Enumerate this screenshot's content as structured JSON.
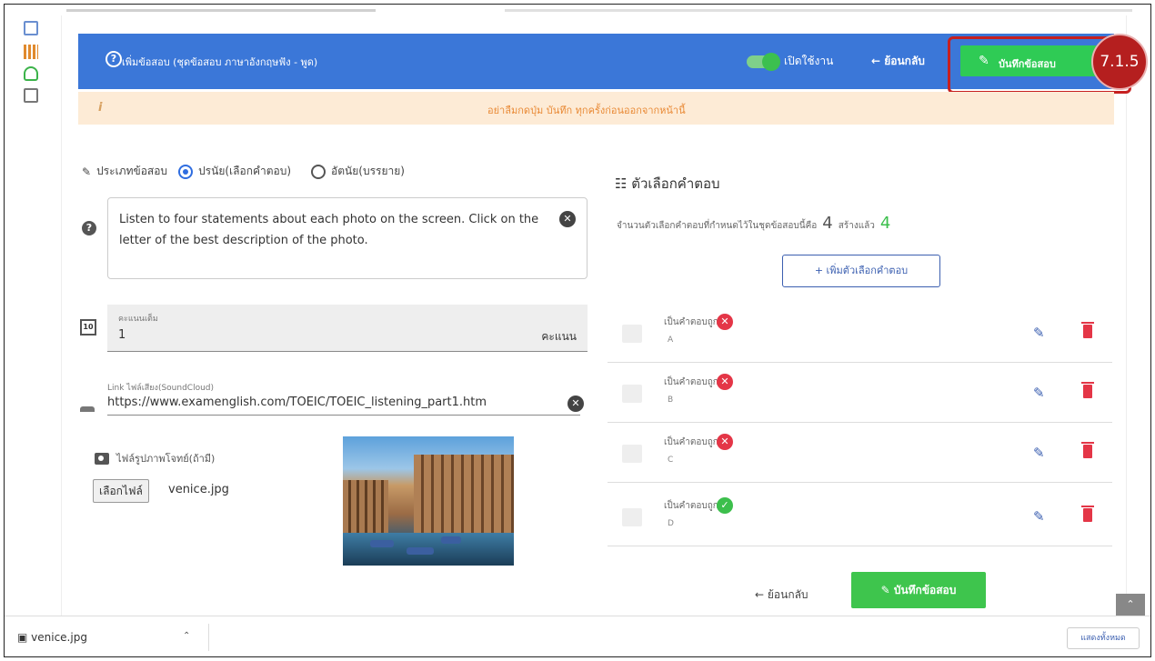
{
  "header": {
    "title": "เพิ่มข้อสอบ (ชุดข้อสอบ ภาษาอังกฤษฟัง - พูด)",
    "toggle_label": "เปิดใช้งาน",
    "back_label": "ย้อนกลับ",
    "save_label": "บันทึกข้อสอบ"
  },
  "annotation": {
    "step_label": "7.1.5"
  },
  "notice": {
    "icon": "i",
    "text": "อย่าลืมกดปุ่ม บันทึก ทุกครั้งก่อนออกจากหน้านี้"
  },
  "question": {
    "type_label": "ประเภทข้อสอบ",
    "option_objective": "ปรนัย(เลือกคำตอบ)",
    "option_subjective": "อัตนัย(บรรยาย)",
    "text": "Listen to four statements about each photo on the screen. Click on the letter of the best description of the photo."
  },
  "score": {
    "label": "คะแนนเต็ม",
    "value": "1",
    "unit": "คะแนน",
    "icon_text": "10"
  },
  "audio": {
    "label": "Link ไฟล์เสียง(SoundCloud)",
    "value": "https://www.examenglish.com/TOEIC/TOEIC_listening_part1.htm"
  },
  "image": {
    "label": "ไฟล์รูปภาพโจทย์(ถ้ามี)",
    "choose_label": "เลือกไฟล์",
    "filename": "venice.jpg"
  },
  "answers": {
    "title": "ตัวเลือกคำตอบ",
    "count_label": "จำนวนตัวเลือกคำตอบที่กำหนดไว้ในชุดข้อสอบนี้คือ",
    "count": "4",
    "created_label": "สร้างแล้ว",
    "created": "4",
    "add_label": "+ เพิ่มตัวเลือกคำตอบ",
    "items": [
      {
        "correct_label": "เป็นคำตอบถูก",
        "key": "A",
        "status": "wrong"
      },
      {
        "correct_label": "เป็นคำตอบถูก",
        "key": "B",
        "status": "wrong"
      },
      {
        "correct_label": "เป็นคำตอบถูก",
        "key": "C",
        "status": "wrong"
      },
      {
        "correct_label": "เป็นคำตอบถูก",
        "key": "D",
        "status": "correct"
      }
    ]
  },
  "footer": {
    "back_label": "ย้อนกลับ",
    "save_label": "บันทึกข้อสอบ"
  },
  "downloads": {
    "file": "venice.jpg",
    "show_all": "แสดงทั้งหมด"
  },
  "colors": {
    "header": "#3b77d8",
    "save": "#2fcb55",
    "annotation": "#c62020",
    "wrong": "#e43647",
    "correct": "#3cbf4c"
  }
}
